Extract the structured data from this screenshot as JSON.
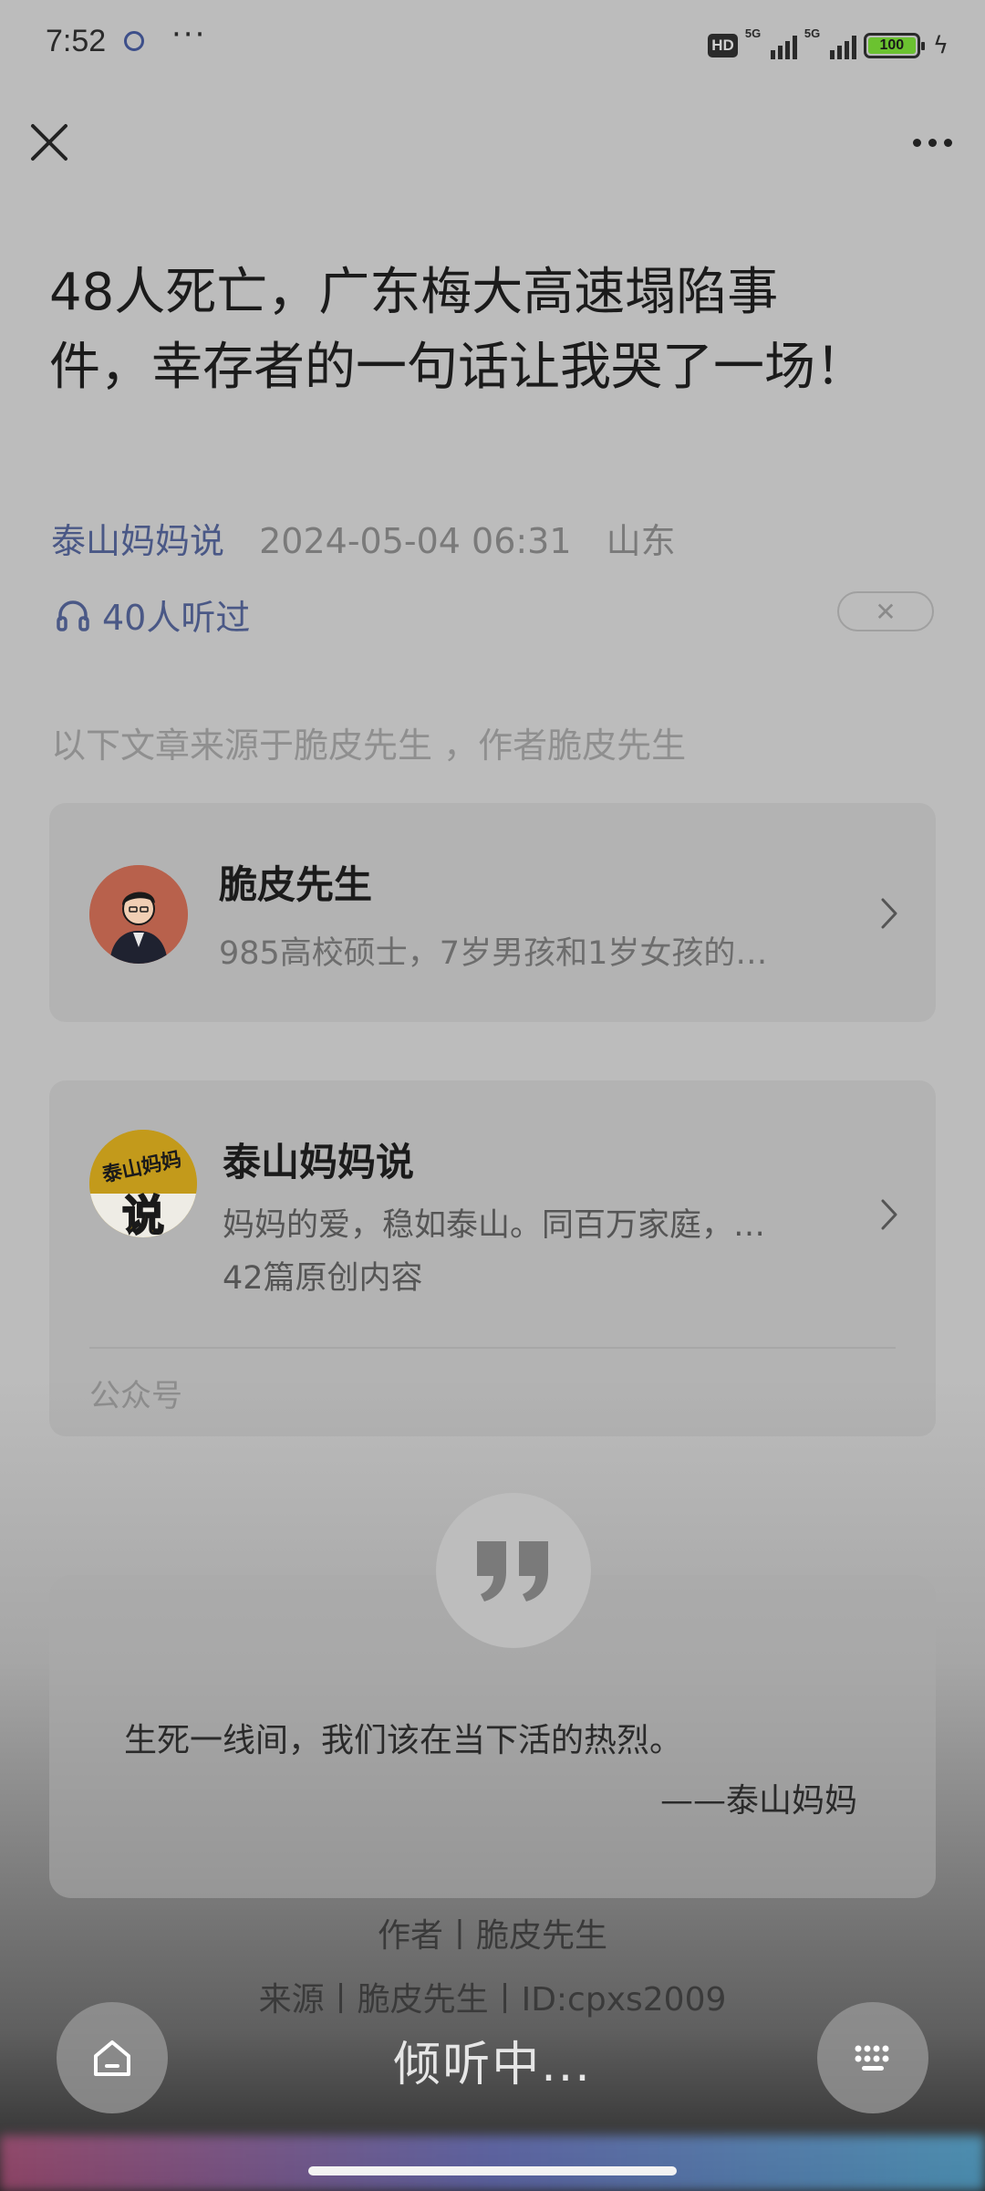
{
  "status_bar": {
    "time": "7:52",
    "dots": "···",
    "hd": "HD",
    "signal1": "5G",
    "signal2": "5G",
    "battery": "100",
    "battery_color": "#6bc230"
  },
  "nav": {
    "close_icon": "close-icon",
    "more_icon": "more-icon"
  },
  "article": {
    "title": "48人死亡，广东梅大高速塌陷事件，幸存者的一句话让我哭了一场！",
    "author": "泰山妈妈说",
    "datetime": "2024-05-04 06:31",
    "location": "山东",
    "listened": "40人听过",
    "source_line": "以下文章来源于脆皮先生 ，作者脆皮先生"
  },
  "source_card": {
    "name": "脆皮先生",
    "desc": "985高校硕士，7岁男孩和1岁女孩的…"
  },
  "account_card": {
    "name": "泰山妈妈说",
    "desc": "妈妈的爱，稳如泰山。同百万家庭，…",
    "count": "42篇原创内容",
    "footer": "公众号",
    "avatar_text_top": "泰山妈妈",
    "avatar_text_big": "说"
  },
  "quote": {
    "text": "生死一线间，我们该在当下活的热烈。",
    "sign": "——泰山妈妈"
  },
  "credits": {
    "author_line": "作者丨脆皮先生",
    "source_line": "来源丨脆皮先生丨ID:cpxs2009"
  },
  "voice_bar": {
    "status": "倾听中..."
  },
  "colors": {
    "link": "#4a5886",
    "background": "#bcbcbc"
  }
}
